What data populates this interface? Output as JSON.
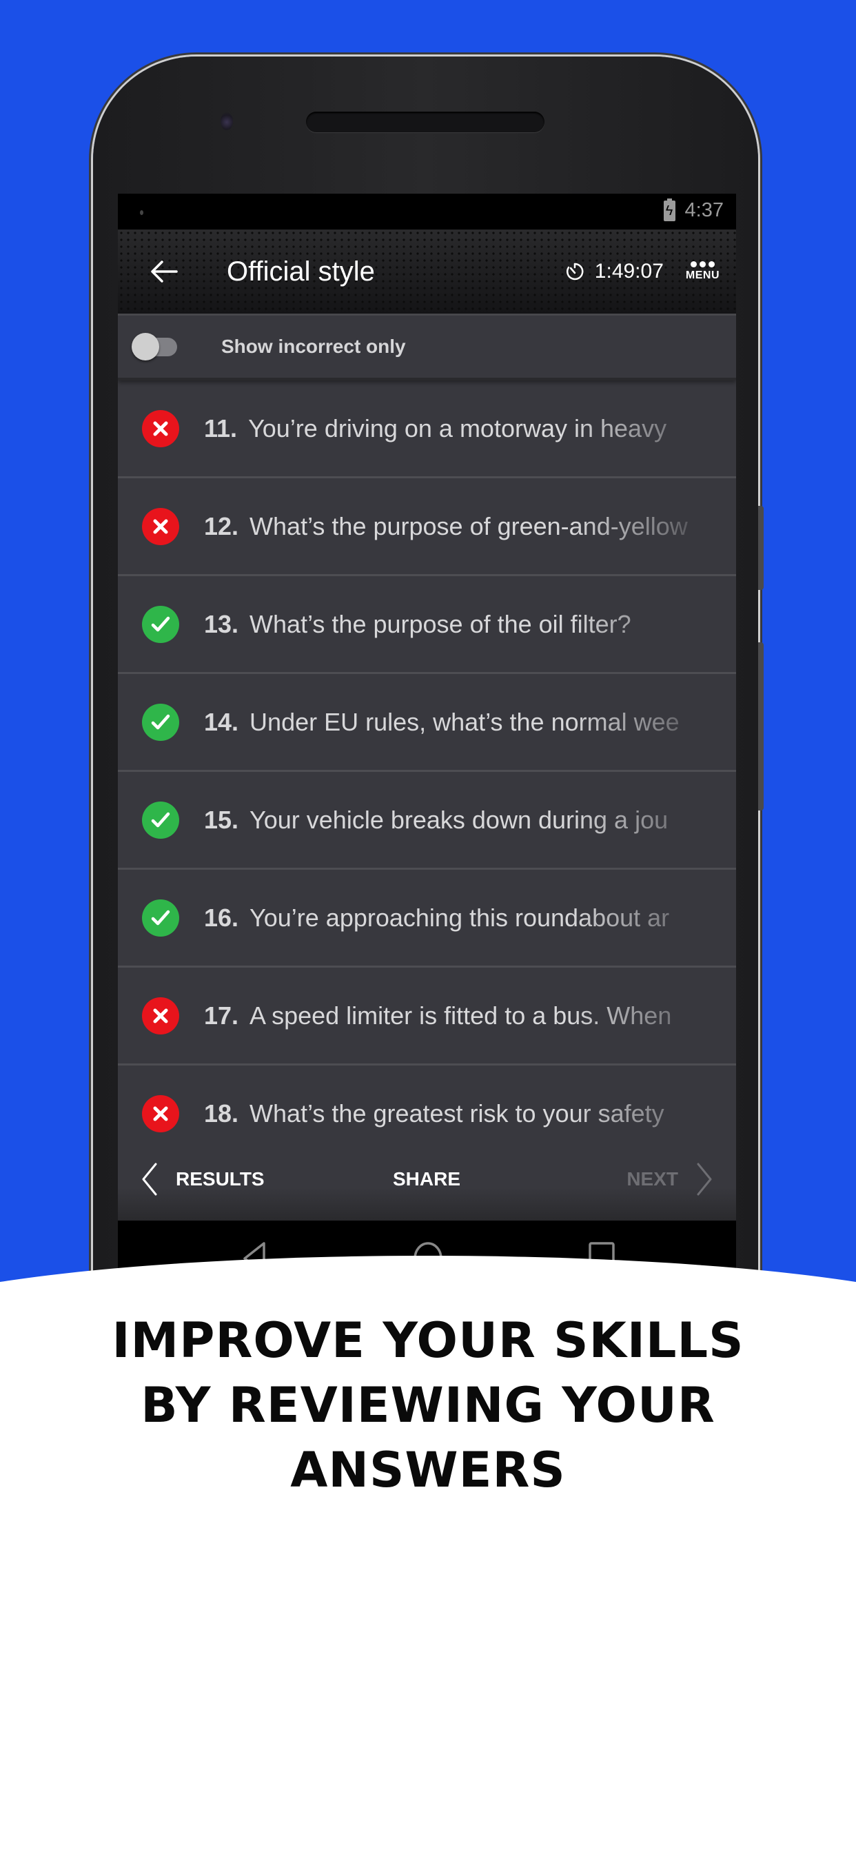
{
  "status_bar": {
    "time": "4:37",
    "battery_icon": "battery-charging-icon"
  },
  "app_bar": {
    "back_icon": "arrow-left-icon",
    "title": "Official style",
    "timer_icon": "stopwatch-icon",
    "timer_value": "1:49:07",
    "menu_icon": "more-dots-icon",
    "menu_label": "MENU"
  },
  "filter": {
    "toggle_label": "Show incorrect only",
    "toggle_on": false
  },
  "questions": [
    {
      "number": "11.",
      "text": "You’re driving on a motorway in heavy",
      "result": "incorrect"
    },
    {
      "number": "12.",
      "text": "What’s the purpose of green-and-yellow",
      "result": "incorrect"
    },
    {
      "number": "13.",
      "text": "What’s the purpose of the oil filter?",
      "result": "correct"
    },
    {
      "number": "14.",
      "text": "Under EU rules, what’s the normal wee",
      "result": "correct"
    },
    {
      "number": "15.",
      "text": "Your vehicle breaks down during a jou",
      "result": "correct"
    },
    {
      "number": "16.",
      "text": "You’re approaching this roundabout ar",
      "result": "correct"
    },
    {
      "number": "17.",
      "text": "A speed limiter is fitted to a bus. When",
      "result": "incorrect"
    },
    {
      "number": "18.",
      "text": "What’s the greatest risk to your safety",
      "result": "incorrect"
    }
  ],
  "bottom_nav": {
    "results_label": "RESULTS",
    "share_label": "SHARE",
    "next_label": "NEXT",
    "next_enabled": false
  },
  "system_nav": {
    "back_icon": "triangle-back-icon",
    "home_icon": "circle-home-icon",
    "recents_icon": "square-recents-icon"
  },
  "promo": {
    "lines": [
      "IMPROVE YOUR SKILLS",
      "BY REVIEWING YOUR",
      "ANSWERS"
    ]
  },
  "colors": {
    "background": "#1b50e8",
    "incorrect": "#e8141c",
    "correct": "#2fb64a",
    "list_bg": "#38383e"
  }
}
